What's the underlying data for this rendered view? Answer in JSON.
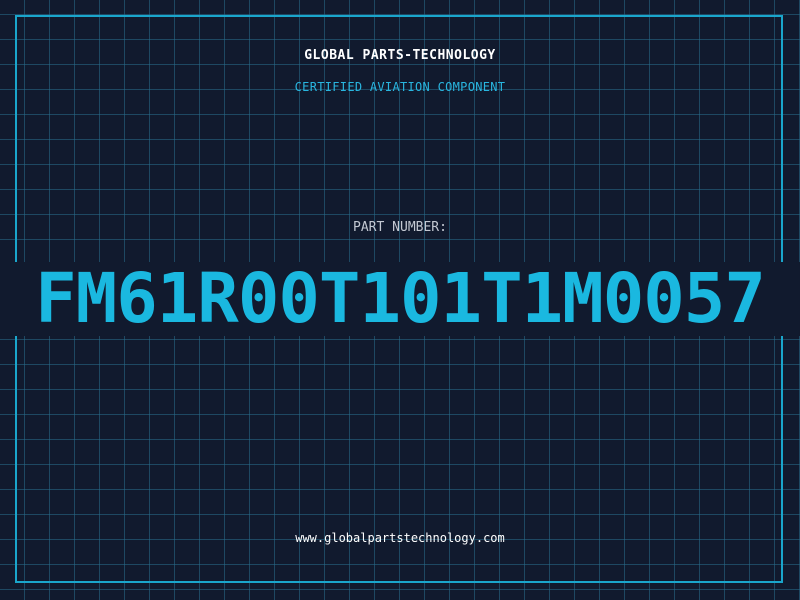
{
  "header": {
    "brand": "GLOBAL PARTS-TECHNOLOGY",
    "subtitle": "CERTIFIED AVIATION COMPONENT"
  },
  "part": {
    "label": "PART NUMBER:",
    "number": "FM61R00T101T1M0057"
  },
  "footer": {
    "website": "www.globalpartstechnology.com"
  },
  "colors": {
    "background": "#111a2e",
    "grid": "#286e8c",
    "accent": "#1ab8e0",
    "frame": "#1aa6cc",
    "text": "#ffffff"
  }
}
